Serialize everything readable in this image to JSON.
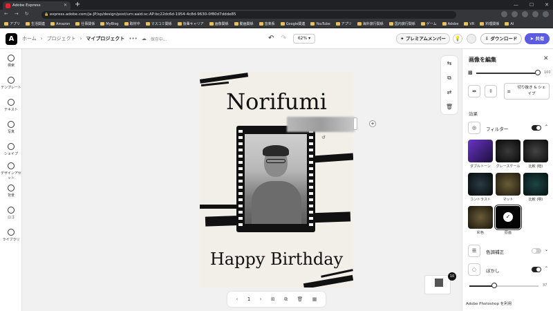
{
  "browser": {
    "tab_title": "Adobe Express",
    "url": "express.adobe.com/ja-JP/sp/design/post/urn:aaid:sc:AP:bc22dc6d-1954-4c8d-9630-0f80d7ddde85",
    "bookmarks": [
      "アプリ",
      "生活関連",
      "Amazon",
      "仕事関係",
      "MyBlog",
      "取材中",
      "マスコミ関係",
      "後輩キャリア",
      "画像関係",
      "動画関係",
      "音楽系",
      "Google関連",
      "YouTube",
      "アプリ",
      "海外旅行関係",
      "国内旅行関係",
      "ゲーム",
      "Adobe",
      "VR",
      "料理関係",
      "AI"
    ]
  },
  "header": {
    "home": "ホーム",
    "project": "プロジェクト",
    "my_project": "マイプロジェクト",
    "more": "•••",
    "saving": "保存中...",
    "zoom": "62%",
    "premium": "✦ プレミアムメンバー",
    "download": "⇩ ダウンロード",
    "publish": "➤ 共有"
  },
  "sidebar": {
    "items": [
      {
        "label": "検索",
        "icon": "search-icon"
      },
      {
        "label": "テンプレート",
        "icon": "template-icon"
      },
      {
        "label": "テキスト",
        "icon": "text-icon"
      },
      {
        "label": "写真",
        "icon": "photo-icon"
      },
      {
        "label": "シェイプ",
        "icon": "shape-icon"
      },
      {
        "label": "デザインアセット",
        "icon": "design-asset-icon"
      },
      {
        "label": "背景",
        "icon": "background-icon"
      },
      {
        "label": "ロゴ",
        "icon": "logo-icon"
      },
      {
        "label": "ライブラリ",
        "icon": "library-icon"
      }
    ]
  },
  "canvas": {
    "name": "Norifumi",
    "greeting": "Happy Birthday",
    "page_number": "1",
    "page_count_badge": "10"
  },
  "panel": {
    "title": "画像を編集",
    "opacity_value": "100",
    "crop_label": "切り抜き & シェイプ",
    "effects_label": "効果",
    "filter_label": "フィルター",
    "filter_on": true,
    "filters": [
      {
        "name": "ダブルトーン",
        "color": "#4a2c8c"
      },
      {
        "name": "グレースケール",
        "color": "#151515"
      },
      {
        "name": "比較 (暗)",
        "color": "#1a1a1a"
      },
      {
        "name": "コントラスト",
        "color": "#0d1a22"
      },
      {
        "name": "マット",
        "color": "#3a3320"
      },
      {
        "name": "比較 (明)",
        "color": "#0f2424"
      },
      {
        "name": "彩色",
        "color": "#3b3420"
      },
      {
        "name": "原画",
        "color": "#050505"
      }
    ],
    "selected_filter": "原画",
    "color_adjust_label": "色調補正",
    "color_adjust_on": false,
    "blur_label": "ぼかし",
    "blur_on": true,
    "blur_value": "37",
    "photoshop_note": "Adobe Photoshop を利用"
  }
}
